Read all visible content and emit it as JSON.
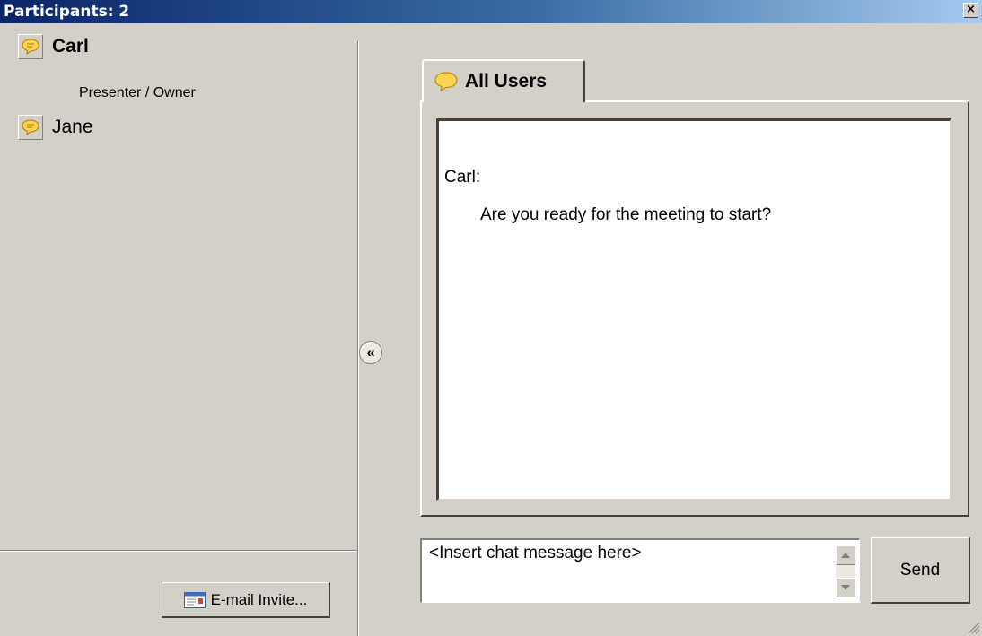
{
  "window": {
    "title": "Participants: 2",
    "close_glyph": "×"
  },
  "participants": [
    {
      "name": "Carl",
      "role": "Presenter / Owner",
      "icon": "chat-bubble-icon"
    },
    {
      "name": "Jane",
      "icon": "chat-bubble-icon"
    }
  ],
  "email_invite": {
    "label": "E-mail Invite...",
    "icon": "email-icon"
  },
  "collapse": {
    "glyph": "«"
  },
  "chat": {
    "tab_label": "All Users",
    "messages": [
      {
        "sender": "Carl:",
        "text": "Are you ready for the meeting to start?"
      }
    ],
    "input_placeholder": "<Insert chat message here>",
    "send_label": "Send"
  },
  "colors": {
    "background": "#d4d0c8",
    "title_start": "#0a246a",
    "title_end": "#a6caf0",
    "bubble": "#fcd44c"
  }
}
